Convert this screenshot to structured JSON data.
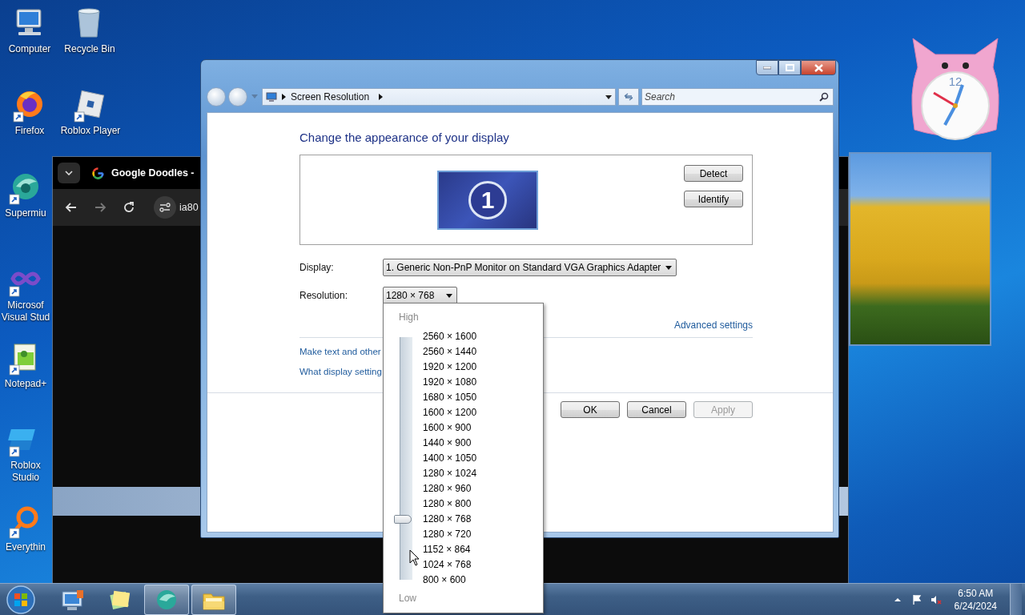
{
  "desktop_icons": [
    {
      "label": "Computer",
      "kind": "computer",
      "shortcut": false
    },
    {
      "label": "Recycle Bin",
      "kind": "recycle-bin",
      "shortcut": false
    },
    {
      "label": "Firefox",
      "kind": "firefox",
      "shortcut": true
    },
    {
      "label": "Roblox Player",
      "kind": "roblox",
      "shortcut": true
    },
    {
      "label": "Supermiu",
      "kind": "supermium",
      "shortcut": true
    },
    {
      "label": "Microsof Visual Stud",
      "kind": "visual-studio",
      "shortcut": true
    },
    {
      "label": "Notepad+",
      "kind": "notepad",
      "shortcut": true
    },
    {
      "label": "Roblox Studio",
      "kind": "roblox-studio",
      "shortcut": true
    },
    {
      "label": "Everythin",
      "kind": "everything",
      "shortcut": true
    }
  ],
  "browser": {
    "tab_title": "Google Doodles -",
    "address": "ia80"
  },
  "dialog": {
    "address_path": "Screen Resolution",
    "search_placeholder": "Search",
    "heading": "Change the appearance of your display",
    "monitor_number": "1",
    "preview_buttons": [
      "Detect",
      "Identify"
    ],
    "display": {
      "label": "Display:",
      "value": "1. Generic Non-PnP Monitor on Standard VGA Graphics Adapter"
    },
    "resolution": {
      "label": "Resolution:",
      "value": "1280 × 768"
    },
    "advanced_link": "Advanced settings",
    "links": [
      "Make text and other",
      "What display setting"
    ],
    "buttons": [
      {
        "label": "OK",
        "disabled": false
      },
      {
        "label": "Cancel",
        "disabled": false
      },
      {
        "label": "Apply",
        "disabled": true
      }
    ]
  },
  "resolution_dropdown": {
    "high_label": "High",
    "low_label": "Low",
    "level": 0.25,
    "options": [
      "2560 × 1600",
      "2560 × 1440",
      "1920 × 1200",
      "1920 × 1080",
      "1680 × 1050",
      "1600 × 1200",
      "1600 × 900",
      "1440 × 900",
      "1400 × 1050",
      "1280 × 1024",
      "1280 × 960",
      "1280 × 800",
      "1280 × 768",
      "1280 × 720",
      "1152 × 864",
      "1024 × 768",
      "800 × 600"
    ]
  },
  "clock_gadget": {
    "numeral": "12"
  },
  "taskbar": {
    "items": [
      {
        "kind": "remote-desktop",
        "running": false
      },
      {
        "kind": "sticky-notes",
        "running": false
      },
      {
        "kind": "supermium",
        "running": true
      },
      {
        "kind": "explorer",
        "running": true
      }
    ],
    "time": "6:50 AM",
    "date": "6/24/2024"
  }
}
